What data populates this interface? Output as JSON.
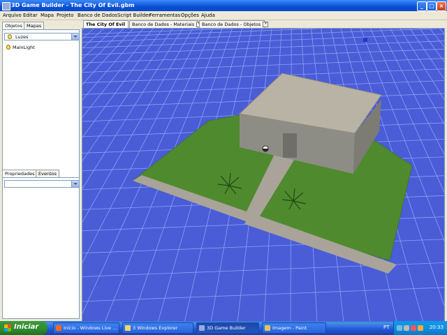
{
  "window": {
    "title": "3D Game Builder - The City Of Evil.gbm",
    "controls": [
      "_",
      "□",
      "×"
    ]
  },
  "menu": [
    "Arquivo",
    "Editar",
    "Mapa",
    "Projeto",
    "Banco de Dados",
    "Script Builder",
    "Ferramentas",
    "Opções",
    "Ajuda"
  ],
  "left_panel": {
    "tabs": [
      "Objetos",
      "Mapas"
    ],
    "active_tab": "Objetos",
    "category_select": "Luzes",
    "items": [
      {
        "label": "MainLight",
        "icon": "light-bulb-icon"
      }
    ],
    "bottom_tabs": [
      "Propriedades",
      "Eventos"
    ],
    "active_bottom_tab": "Propriedades",
    "property_select": ""
  },
  "document_tabs": [
    {
      "label": "The City Of Evil",
      "active": true,
      "closable": false
    },
    {
      "label": "Banco de Dados - Materiais",
      "active": false,
      "closable": true
    },
    {
      "label": "Banco de Dados - Objetos",
      "active": false,
      "closable": true
    }
  ],
  "viewport": {
    "background_color": "#4a5dd7",
    "grid_color": "#8da0f4",
    "grass_color": "#4f8a2e",
    "path_color": "#a9a39a",
    "building_roof_color": "#b9b3a6",
    "building_wall_color": "#8e8d85"
  },
  "taskbar": {
    "start_label": "Iniciar",
    "buttons": [
      {
        "label": "Início - Windows Live ...",
        "icon": "browser-icon",
        "active": false
      },
      {
        "label": "3 Windows Explorer",
        "icon": "folder-icon",
        "active": false
      },
      {
        "label": "3D Game Builder",
        "icon": "app-icon",
        "active": true
      },
      {
        "label": "Imagem - Paint",
        "icon": "paint-icon",
        "active": false
      }
    ],
    "language": "PT",
    "clock": "20:33"
  }
}
